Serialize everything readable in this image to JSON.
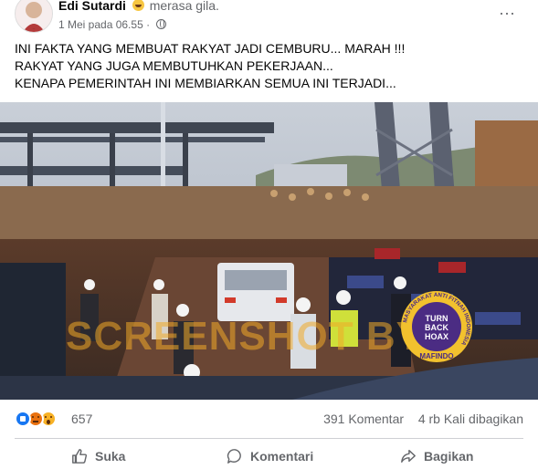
{
  "post": {
    "author": "Edi Sutardi",
    "feeling": "merasa gila.",
    "timestamp": "1 Mei pada 06.55",
    "separator": "·",
    "more_label": "···",
    "text_lines": [
      "INI FAKTA YANG MEMBUAT RAKYAT JADI CEMBURU... MARAH !!!",
      "RAKYAT YANG JUGA MEMBUTUHKAN PEKERJAAN...",
      "KENAPA PEMERINTAH INI MEMBIARKAN SEMUA INI TERJADI..."
    ]
  },
  "media": {
    "watermark": "SCREENSHOT BY",
    "badge": {
      "line1": "TURN",
      "line2": "BACK",
      "line3": "HOAX",
      "name": "MAFINDO",
      "ring_text": "MASYARAKAT ANTI FITNAH INDONESIA"
    }
  },
  "stats": {
    "reactions": [
      "like",
      "angry",
      "wow"
    ],
    "reaction_count": "657",
    "comments": "391 Komentar",
    "shares": "4 rb Kali dibagikan"
  },
  "actions": {
    "like": "Suka",
    "comment": "Komentari",
    "share": "Bagikan"
  },
  "colors": {
    "text_secondary": "#65676b",
    "like_blue": "#1877f2",
    "watermark": "#f0aa28",
    "badge_purple": "#4b2c83",
    "badge_yellow": "#f2c12e"
  }
}
